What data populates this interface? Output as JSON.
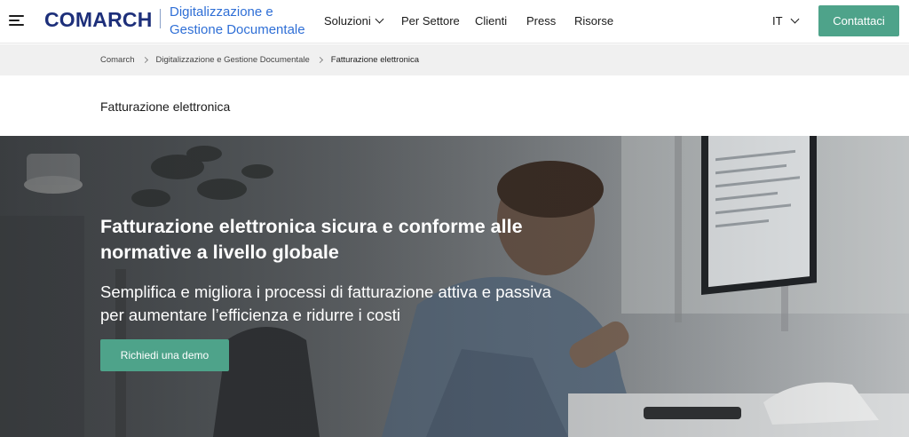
{
  "header": {
    "logo_text": "COMARCH",
    "product_title": "Digitalizzazione e Gestione Documentale",
    "nav": [
      {
        "label": "Soluzioni",
        "has_dropdown": true
      },
      {
        "label": "Per Settore"
      },
      {
        "label": "Clienti"
      },
      {
        "label": "Press"
      },
      {
        "label": "Risorse"
      }
    ],
    "language": "IT",
    "contact_label": "Contattaci",
    "icons": [
      "menu-icon",
      "chevron-down-icon"
    ]
  },
  "breadcrumb": [
    {
      "label": "Comarch"
    },
    {
      "label": "Digitalizzazione e Gestione Documentale"
    },
    {
      "label": "Fatturazione elettronica"
    }
  ],
  "page": {
    "title": "Fatturazione elettronica"
  },
  "hero": {
    "heading": "Fatturazione elettronica sicura e conforme alle normative a livello globale",
    "subheading": "Semplifica e migliora i processi di fatturazione attiva e passiva per aumentare l’efficienza e ridurre i costi",
    "cta_label": "Richiedi una demo"
  },
  "colors": {
    "brand_navy": "#1d2f7a",
    "brand_blue": "#2f6fd6",
    "accent_green": "#4ea38a",
    "breadcrumb_bg": "#f0f0f0"
  }
}
